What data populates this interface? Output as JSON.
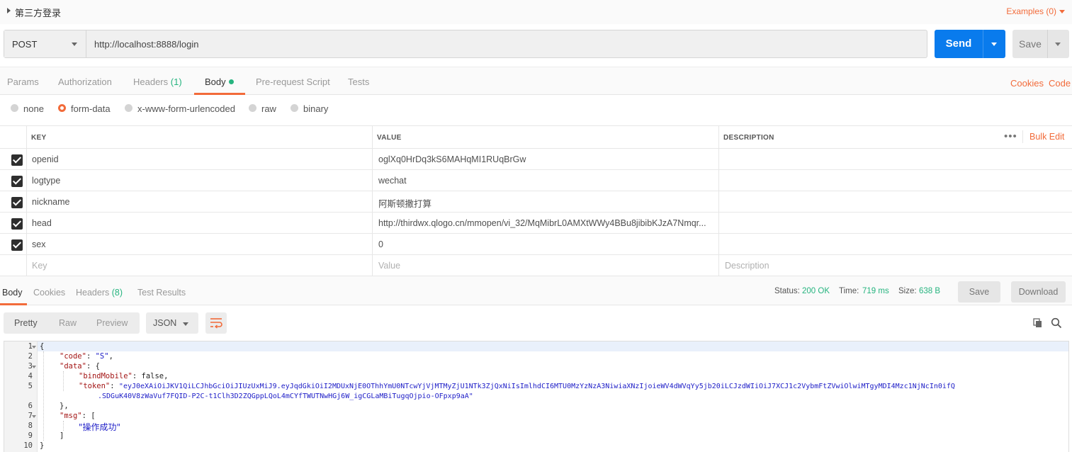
{
  "request_name": "第三方登录",
  "examples_label": "Examples (0)",
  "method": "POST",
  "url": "http://localhost:8888/login",
  "send_label": "Send",
  "save_label": "Save",
  "request_tabs": {
    "params": "Params",
    "authorization": "Authorization",
    "headers": "Headers",
    "headers_count": "(1)",
    "body": "Body",
    "prerequest": "Pre-request Script",
    "tests": "Tests"
  },
  "cookies_link": "Cookies",
  "code_link": "Code",
  "body_types": [
    "none",
    "form-data",
    "x-www-form-urlencoded",
    "raw",
    "binary"
  ],
  "selected_body_type": "form-data",
  "table": {
    "headers": {
      "key": "KEY",
      "value": "VALUE",
      "description": "DESCRIPTION"
    },
    "more_label": "•••",
    "bulk_edit": "Bulk Edit",
    "rows": [
      {
        "key": "openid",
        "value": "oglXq0HrDq3kS6MAHqMI1RUqBrGw",
        "checked": true
      },
      {
        "key": "logtype",
        "value": "wechat",
        "checked": true
      },
      {
        "key": "nickname",
        "value": "阿斯顿撒打算",
        "checked": true
      },
      {
        "key": "head",
        "value": "http://thirdwx.qlogo.cn/mmopen/vi_32/MqMibrL0AMXtWWy4BBu8jibibKJzA7Nmqr...",
        "checked": true
      },
      {
        "key": "sex",
        "value": "0",
        "checked": true
      }
    ],
    "placeholders": {
      "key": "Key",
      "value": "Value",
      "description": "Description"
    }
  },
  "response": {
    "tabs": {
      "body": "Body",
      "cookies": "Cookies",
      "headers": "Headers",
      "headers_count": "(8)",
      "test_results": "Test Results"
    },
    "status_label": "Status:",
    "status_value": "200 OK",
    "time_label": "Time:",
    "time_value": "719 ms",
    "size_label": "Size:",
    "size_value": "638 B",
    "save_label": "Save",
    "download_label": "Download",
    "views": [
      "Pretty",
      "Raw",
      "Preview"
    ],
    "active_view": "Pretty",
    "format": "JSON"
  },
  "code": {
    "line_numbers": [
      "1",
      "2",
      "3",
      "4",
      "5",
      "",
      "6",
      "7",
      "8",
      "9",
      "10"
    ],
    "l1": "{",
    "l2_key": "\"code\"",
    "l2_val": "\"S\"",
    "l3_key": "\"data\"",
    "l3_rest": ": {",
    "l4_key": "\"bindMobile\"",
    "l4_rest": ": false,",
    "l5_key": "\"token\"",
    "l5_val_a": "\"eyJ0eXAiOiJKV1QiLCJhbGciOiJIUzUxMiJ9.eyJqdGkiOiI2MDUxNjE0OThhYmU0NTcwYjVjMTMyZjU1NTk3ZjQxNiIsImlhdCI6MTU0MzYzNzA3NiwiaXNzIjoieWV4dWVqYy5jb20iLCJzdWIiOiJ7XCJ1c2VybmFtZVwiOlwiMTgyMDI4Mzc1NjNcIn0ifQ",
    "l5_val_b": ".SDGuK40V8zWaVuf7FQID-P2C-t1Clh3D2ZQGppLQoL4mCYfTWUTNwHGj6W_igCGLaMBiTugqOjpio-OFpxp9aA\"",
    "l6": "},",
    "l7_key": "\"msg\"",
    "l7_rest": ": [",
    "l8_val": "\"操作成功\"",
    "l9": "]",
    "l10": "}"
  },
  "colors": {
    "accent": "#f26b3a",
    "send": "#097bed",
    "success": "#26b47f"
  }
}
